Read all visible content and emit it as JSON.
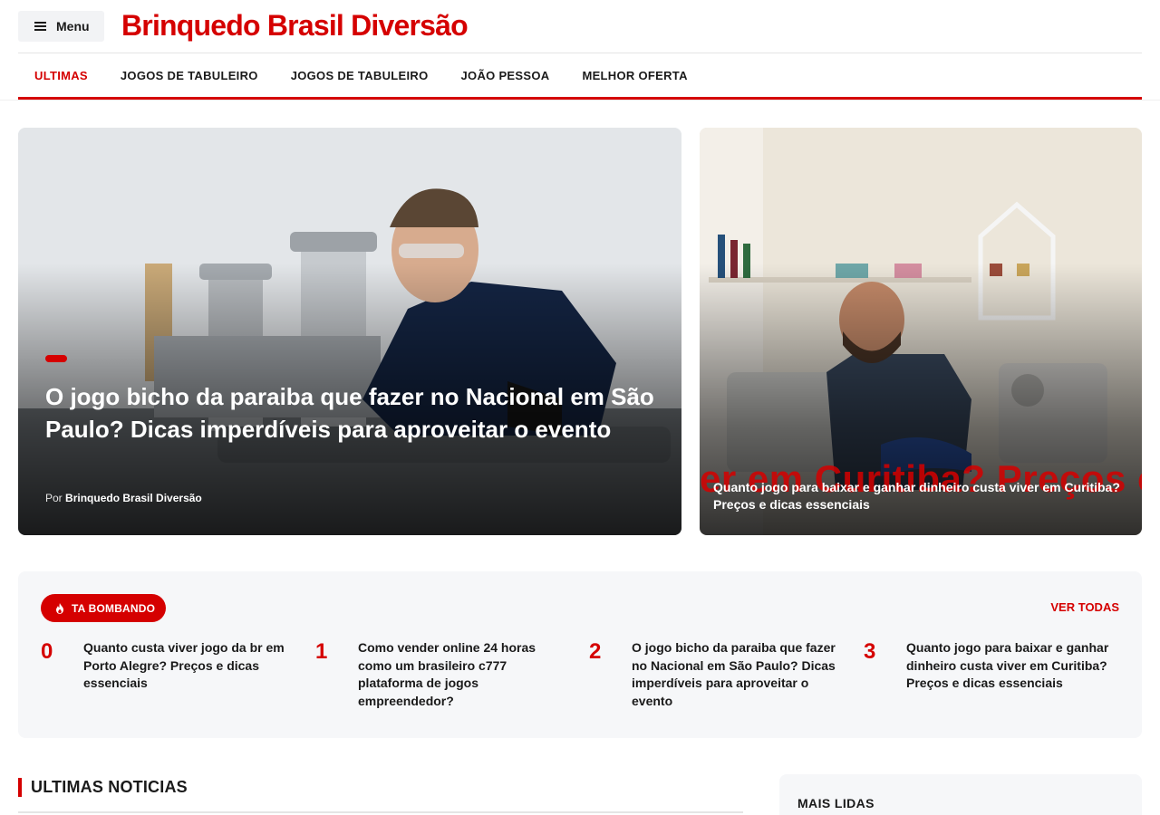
{
  "header": {
    "menu_label": "Menu",
    "site_title": "Brinquedo Brasil Diversão"
  },
  "nav": {
    "items": [
      {
        "label": "ULTIMAS",
        "active": true
      },
      {
        "label": "JOGOS DE TABULEIRO",
        "active": false
      },
      {
        "label": "JOGOS DE TABULEIRO",
        "active": false
      },
      {
        "label": "JOÃO PESSOA",
        "active": false
      },
      {
        "label": "MELHOR OFERTA",
        "active": false
      }
    ]
  },
  "hero_main": {
    "title": "O jogo bicho da paraiba que fazer no Nacional em São Paulo? Dicas imperdíveis para aproveitar o evento",
    "byline_prefix": "Por",
    "author": "Brinquedo Brasil Diversão"
  },
  "hero_side": {
    "ghost_text": "er em Curitiba? Preços e",
    "title": "Quanto jogo para baixar e ganhar dinheiro custa viver em Curitiba? Preços e dicas essenciais"
  },
  "trending": {
    "badge_label": "TA BOMBANDO",
    "see_all": "VER TODAS",
    "items": [
      {
        "num": "0",
        "title": "Quanto custa viver jogo da br em Porto Alegre? Preços e dicas essenciais"
      },
      {
        "num": "1",
        "title": "Como vender online 24 horas como um brasileiro c777 plataforma de jogos empreendedor?"
      },
      {
        "num": "2",
        "title": "O jogo bicho da paraiba que fazer no Nacional em São Paulo? Dicas imperdíveis para aproveitar o evento"
      },
      {
        "num": "3",
        "title": "Quanto jogo para baixar e ganhar dinheiro custa viver em Curitiba? Preços e dicas essenciais"
      }
    ]
  },
  "latest": {
    "title": "ULTIMAS NOTICIAS"
  },
  "most_read": {
    "title": "MAIS LIDAS"
  },
  "icons": {
    "menu": "hamburger-icon",
    "trending": "fire-icon"
  },
  "colors": {
    "accent": "#d50000",
    "text": "#1a1a1a",
    "panel": "#f6f7f9"
  }
}
